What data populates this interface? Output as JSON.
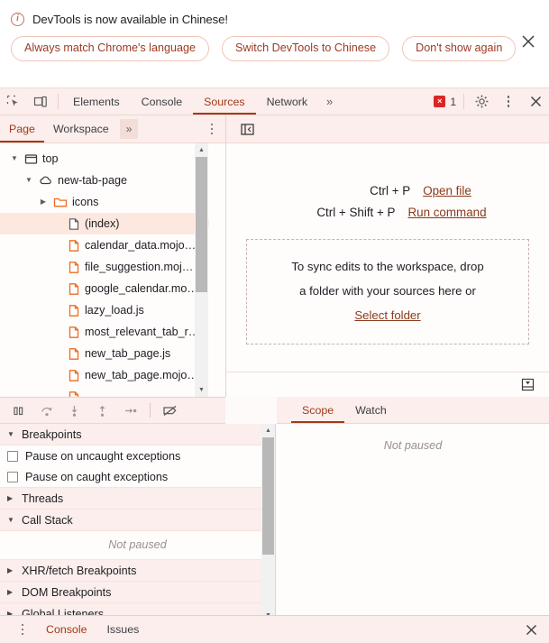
{
  "banner": {
    "icon": "info-circle-icon",
    "message": "DevTools is now available in Chinese!",
    "buttons": [
      {
        "label": "Always match Chrome's language"
      },
      {
        "label": "Switch DevTools to Chinese"
      },
      {
        "label": "Don't show again"
      }
    ],
    "close_icon": "close-icon"
  },
  "main_tabs": {
    "inspect_icon": "inspect-element-icon",
    "device_icon": "device-toolbar-icon",
    "tabs": [
      {
        "label": "Elements",
        "active": false
      },
      {
        "label": "Console",
        "active": false
      },
      {
        "label": "Sources",
        "active": true
      },
      {
        "label": "Network",
        "active": false
      }
    ],
    "more_tabs_icon": "chevron-double-right-icon",
    "more_tabs_label": "»",
    "error_badge": {
      "icon": "error-icon",
      "glyph": "×",
      "count": "1"
    },
    "settings_icon": "gear-icon",
    "menu_icon": "kebab-menu-icon",
    "close_icon": "close-icon"
  },
  "navigator": {
    "tabs": [
      {
        "label": "Page",
        "active": true
      },
      {
        "label": "Workspace",
        "active": false
      }
    ],
    "more_label": "»",
    "menu_icon": "kebab-menu-icon",
    "tree": [
      {
        "label": "top",
        "indent": 0,
        "arrow": "▼",
        "icon": "frame-icon",
        "selected": false
      },
      {
        "label": "new-tab-page",
        "indent": 1,
        "arrow": "▼",
        "icon": "cloud-icon",
        "selected": false
      },
      {
        "label": "icons",
        "indent": 2,
        "arrow": "▶",
        "icon": "folder-icon",
        "selected": false
      },
      {
        "label": "(index)",
        "indent": 3,
        "arrow": "",
        "icon": "document-icon",
        "selected": true
      },
      {
        "label": "calendar_data.mojo…",
        "indent": 3,
        "arrow": "",
        "icon": "file-js-icon",
        "selected": false
      },
      {
        "label": "file_suggestion.moj…",
        "indent": 3,
        "arrow": "",
        "icon": "file-js-icon",
        "selected": false
      },
      {
        "label": "google_calendar.mo…",
        "indent": 3,
        "arrow": "",
        "icon": "file-js-icon",
        "selected": false
      },
      {
        "label": "lazy_load.js",
        "indent": 3,
        "arrow": "",
        "icon": "file-js-icon",
        "selected": false
      },
      {
        "label": "most_relevant_tab_r…",
        "indent": 3,
        "arrow": "",
        "icon": "file-js-icon",
        "selected": false
      },
      {
        "label": "new_tab_page.js",
        "indent": 3,
        "arrow": "",
        "icon": "file-js-icon",
        "selected": false
      },
      {
        "label": "new_tab_page.mojo…",
        "indent": 3,
        "arrow": "",
        "icon": "file-js-icon",
        "selected": false
      },
      {
        "label": "",
        "indent": 3,
        "arrow": "",
        "icon": "file-js-icon",
        "selected": false
      }
    ]
  },
  "editor": {
    "panel_toggle_icon": "show-navigator-icon",
    "shortcuts": [
      {
        "keys": "Ctrl + P",
        "action": "Open file"
      },
      {
        "keys": "Ctrl + Shift + P",
        "action": "Run command"
      }
    ],
    "dropzone": {
      "line1": "To sync edits to the workspace, drop",
      "line2": "a folder with your sources here or",
      "link": "Select folder"
    },
    "status_icon": "show-drawer-icon"
  },
  "debugger": {
    "toolbar": [
      {
        "icon": "pause-script-icon",
        "name": "pause-resume-button"
      },
      {
        "icon": "step-over-icon",
        "name": "step-over-button"
      },
      {
        "icon": "step-into-icon",
        "name": "step-into-button"
      },
      {
        "icon": "step-out-icon",
        "name": "step-out-button"
      },
      {
        "icon": "step-icon",
        "name": "step-button"
      },
      {
        "icon": "deactivate-breakpoints-icon",
        "name": "deactivate-breakpoints-button"
      }
    ],
    "sections": {
      "breakpoints": {
        "title": "Breakpoints",
        "arrow": "▼",
        "checkboxes": [
          {
            "label": "Pause on uncaught exceptions",
            "checked": false
          },
          {
            "label": "Pause on caught exceptions",
            "checked": false
          }
        ]
      },
      "threads": {
        "title": "Threads",
        "arrow": "▶"
      },
      "call_stack": {
        "title": "Call Stack",
        "arrow": "▼",
        "empty_text": "Not paused"
      },
      "xhr": {
        "title": "XHR/fetch Breakpoints",
        "arrow": "▶"
      },
      "dom": {
        "title": "DOM Breakpoints",
        "arrow": "▶"
      },
      "global": {
        "title": "Global Listeners",
        "arrow": "▶"
      }
    }
  },
  "right_panel": {
    "tabs": [
      {
        "label": "Scope",
        "active": true
      },
      {
        "label": "Watch",
        "active": false
      }
    ],
    "empty_text": "Not paused"
  },
  "drawer": {
    "menu_icon": "kebab-menu-icon",
    "tabs": [
      {
        "label": "Console",
        "active": true
      },
      {
        "label": "Issues",
        "active": false
      }
    ],
    "close_icon": "close-icon"
  },
  "colors": {
    "accent": "#a33a16",
    "chrome_bg": "#fbeeec",
    "panel_bg": "#fffcfc",
    "selection": "#fde8e0",
    "error_red": "#dc2626",
    "file_icon": "#f5721f"
  }
}
